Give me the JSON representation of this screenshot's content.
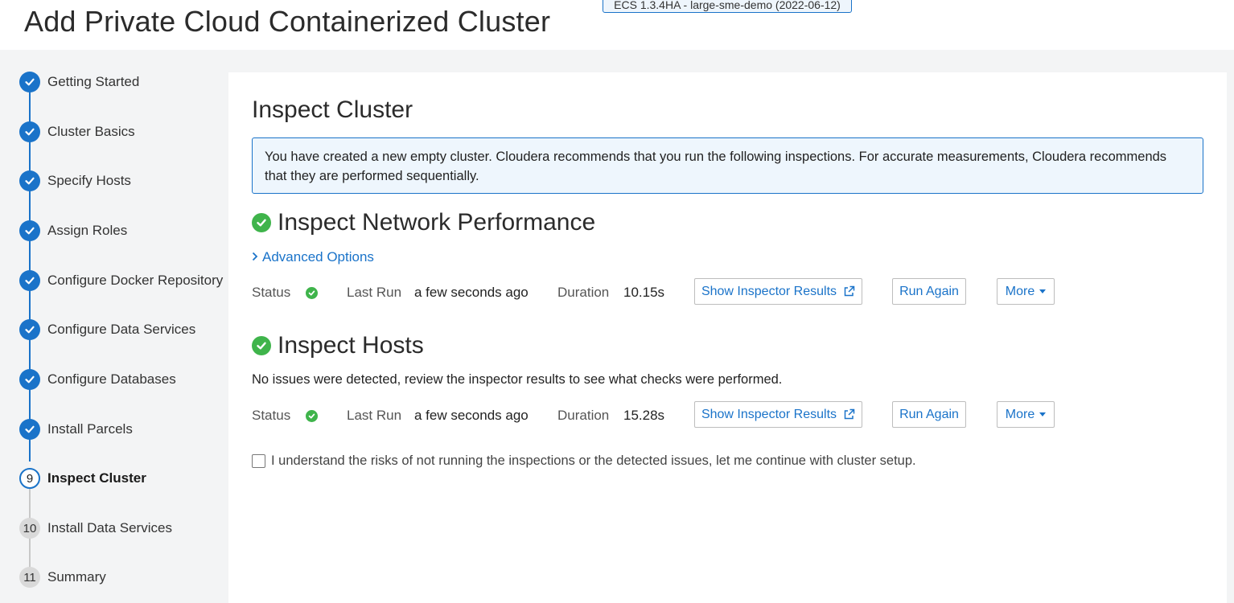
{
  "header": {
    "title": "Add Private Cloud Containerized Cluster",
    "cluster_badge": "ECS 1.3.4HA - large-sme-demo (2022-06-12)"
  },
  "sidebar": {
    "steps": [
      {
        "label": "Getting Started",
        "state": "done"
      },
      {
        "label": "Cluster Basics",
        "state": "done"
      },
      {
        "label": "Specify Hosts",
        "state": "done"
      },
      {
        "label": "Assign Roles",
        "state": "done"
      },
      {
        "label": "Configure Docker Repository",
        "state": "done"
      },
      {
        "label": "Configure Data Services",
        "state": "done"
      },
      {
        "label": "Configure Databases",
        "state": "done"
      },
      {
        "label": "Install Parcels",
        "state": "done"
      },
      {
        "label": "Inspect Cluster",
        "state": "current",
        "number": "9"
      },
      {
        "label": "Install Data Services",
        "state": "pending",
        "number": "10"
      },
      {
        "label": "Summary",
        "state": "pending",
        "number": "11"
      }
    ]
  },
  "main": {
    "title": "Inspect Cluster",
    "info": "You have created a new empty cluster. Cloudera recommends that you run the following inspections. For accurate measurements, Cloudera recommends that they are performed sequentially.",
    "network": {
      "title": "Inspect Network Performance",
      "advanced_label": "Advanced Options",
      "status_label": "Status",
      "last_run_label": "Last Run",
      "last_run_value": "a few seconds ago",
      "duration_label": "Duration",
      "duration_value": "10.15s",
      "show_results_label": "Show Inspector Results",
      "run_again_label": "Run Again",
      "more_label": "More"
    },
    "hosts": {
      "title": "Inspect Hosts",
      "description": "No issues were detected, review the inspector results to see what checks were performed.",
      "status_label": "Status",
      "last_run_label": "Last Run",
      "last_run_value": "a few seconds ago",
      "duration_label": "Duration",
      "duration_value": "15.28s",
      "show_results_label": "Show Inspector Results",
      "run_again_label": "Run Again",
      "more_label": "More"
    },
    "acknowledge": {
      "label": "I understand the risks of not running the inspections or the detected issues, let me continue with cluster setup.",
      "checked": false
    }
  },
  "colors": {
    "accent": "#1a73c9",
    "success": "#3fb44b",
    "sidebar_bg": "#f3f4f5"
  }
}
